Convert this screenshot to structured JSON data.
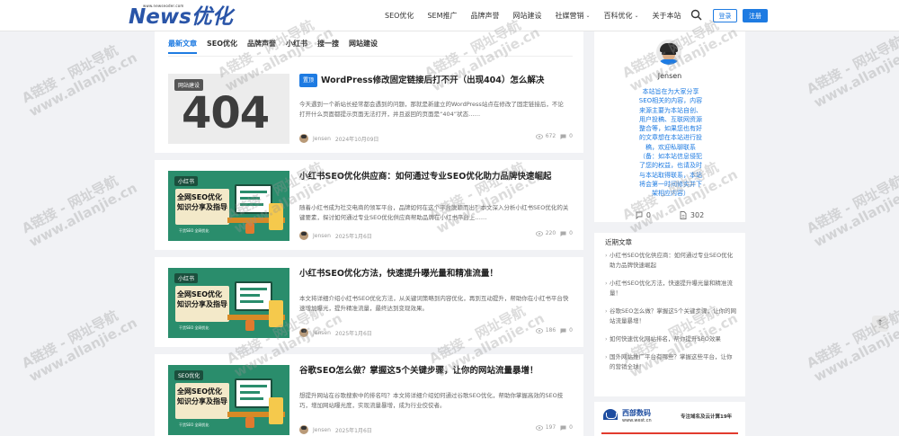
{
  "header": {
    "logo_small": "www.newseoder.com",
    "logo_text": "News优化",
    "nav": [
      {
        "label": "SEO优化",
        "has_caret": false
      },
      {
        "label": "SEM推广",
        "has_caret": false
      },
      {
        "label": "品牌声誉",
        "has_caret": false
      },
      {
        "label": "网站建设",
        "has_caret": false
      },
      {
        "label": "社媒营销",
        "has_caret": true
      },
      {
        "label": "百科优化",
        "has_caret": true
      },
      {
        "label": "关于本站",
        "has_caret": false
      }
    ],
    "login_label": "登录",
    "register_label": "注册"
  },
  "tabs": [
    "最新文章",
    "SEO优化",
    "品牌声誉",
    "小红书",
    "搜一搜",
    "网站建设"
  ],
  "posts": [
    {
      "badge": "置顶",
      "title": "WordPress修改固定链接后打不开（出现404）怎么解决",
      "excerpt": "今天遇到一个新站长经常都会遇到的问题，那就是新建立的WordPress站点在修改了固定链接后，不论打开什么页面都提示页面无法打开，并且返回的页面是“404”状态……",
      "author": "Jensen",
      "date": "2024年10月09日",
      "views": "672",
      "comments": "0",
      "thumb_label": "网站建设",
      "thumb_big": "404"
    },
    {
      "title": "小红书SEO优化供应商：如何通过专业SEO优化助力品牌快速崛起",
      "excerpt": "随着小红书成为社交电商的领军平台，品牌如何在这个平台脱颖而出？本文深入分析小红书SEO优化的关键要素，探讨如何通过专业SEO优化供应商帮助品牌在小红书平台上……",
      "author": "Jensen",
      "date": "2025年1月6日",
      "views": "220",
      "comments": "0",
      "thumb_label": "小红书",
      "thumb_title_1": "全网SEO优化",
      "thumb_title_2": "知识分享及指导",
      "thumb_sub": "干货SEO 全网优化"
    },
    {
      "title": "小红书SEO优化方法，快速提升曝光量和精准流量！",
      "excerpt": "本文将详细介绍小红书SEO优化方法，从关键词策略到内容优化，再到互动提升，帮助你在小红书平台快速增加曝光，提升精准流量，最终达到变现效果。",
      "author": "Jensen",
      "date": "2025年1月6日",
      "views": "186",
      "comments": "0",
      "thumb_label": "小红书",
      "thumb_title_1": "全网SEO优化",
      "thumb_title_2": "知识分享及指导",
      "thumb_sub": "干货SEO 全网优化"
    },
    {
      "title": "谷歌SEO怎么做？掌握这5个关键步骤，让你的网站流量暴增！",
      "excerpt": "想提升网站在谷歌搜索中的排名吗？本文将详细介绍如何通过谷歌SEO优化，帮助你掌握高效的SEO技巧，增加网站曝光度，实现流量暴增，成为行业佼佼者。",
      "author": "Jensen",
      "date": "2025年1月6日",
      "views": "197",
      "comments": "0",
      "thumb_label": "SEO优化",
      "thumb_title_1": "全网SEO优化",
      "thumb_title_2": "知识分享及指导",
      "thumb_sub": "干货SEO 全网优化"
    }
  ],
  "sidebar": {
    "name": "Jensen",
    "desc_lines": [
      "本站旨在为大家分享",
      "SEO相关的内容，内容",
      "来源主要为本站自创、",
      "用户投稿、互联网资源",
      "整合等，如果您也有好",
      "的文章想在本站进行投",
      "稿，欢迎私聊联系",
      "（备：如本站信息侵犯",
      "了您的权益，也请及时",
      "与本站取得联系，本站",
      "将会第一时间修实并下",
      "架相应内容）"
    ],
    "stat_comments": "0",
    "stat_posts": "302",
    "recent_title": "近期文章",
    "recent": [
      "小红书SEO优化供应商：如何通过专业SEO优化助力品牌快速崛起",
      "小红书SEO优化方法，快速提升曝光量和精准流量！",
      "谷歌SEO怎么做？掌握这5个关键步骤，让你的网站流量暴增！",
      "如何快速优化网站排名，帮你提升SEO效果",
      "国外网站推广平台有哪些？掌握这些平台，让你的营销全球！"
    ],
    "ad_brand": "西部数码",
    "ad_url": "www.west.cn",
    "ad_slogan": "专注域名及云计算19年"
  },
  "watermark": {
    "line1": "A链接 - 网址导航",
    "line2": "www.allanjie.cn"
  },
  "colors": {
    "accent": "#1e7be2",
    "logo": "#2a55a8"
  }
}
